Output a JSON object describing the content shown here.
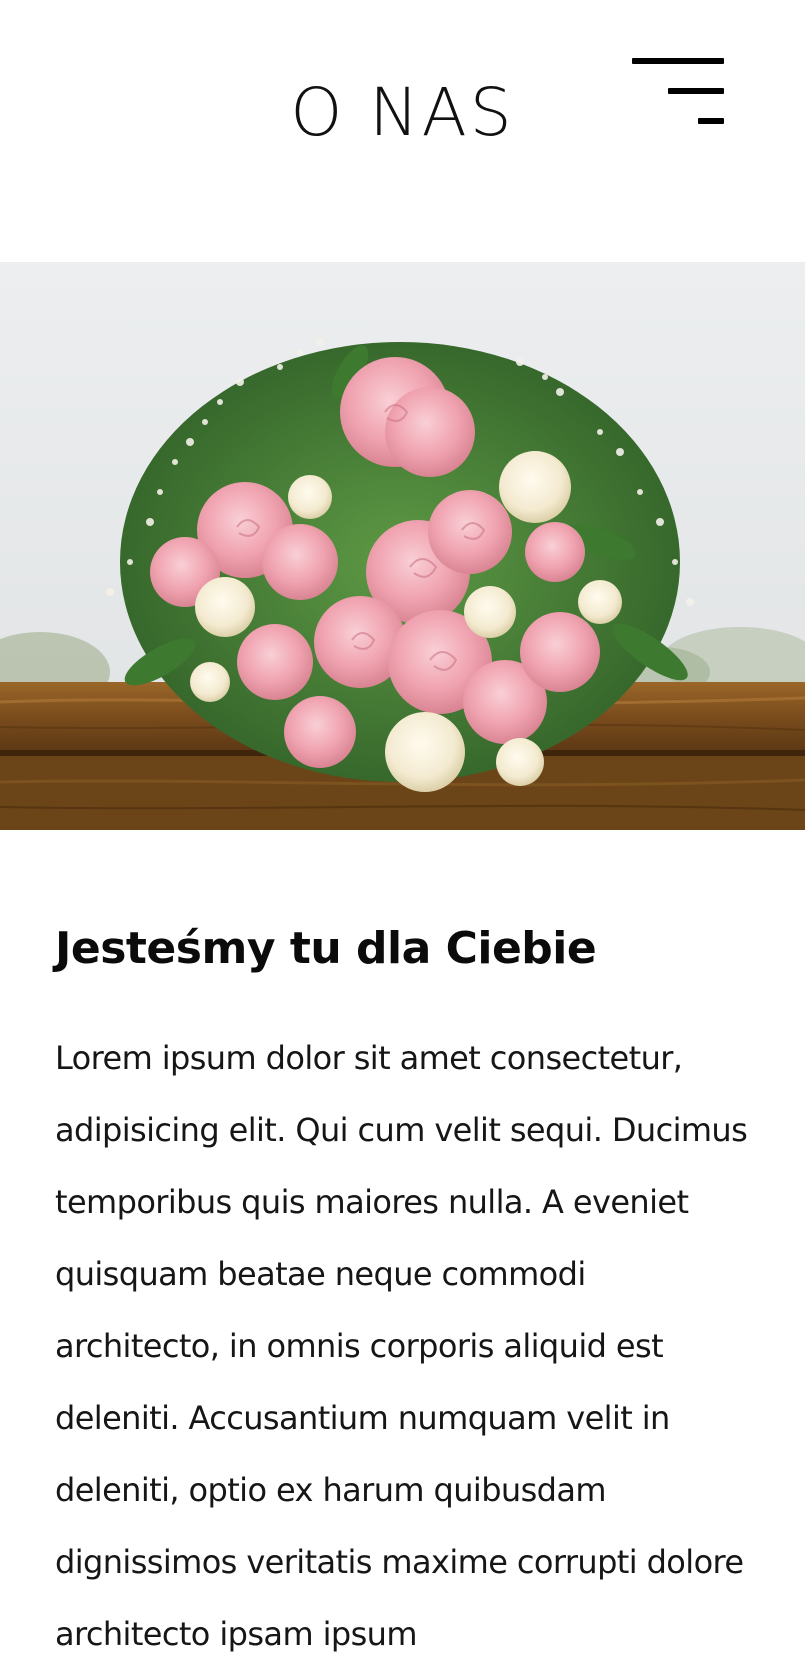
{
  "header": {
    "title": "O NAS",
    "menu_icon": "hamburger-menu-icon"
  },
  "hero": {
    "image_subject": "bouquet of pink and cream roses on a wooden fence",
    "colors": {
      "sky": "#e9eaec",
      "rose_pink": "#f0a8b4",
      "rose_cream": "#f6efd8",
      "leaf": "#3f7a34",
      "wood": "#8a5a24"
    }
  },
  "content": {
    "heading": "Jesteśmy tu dla Ciebie",
    "paragraph": "Lorem ipsum dolor sit amet consectetur, adipisicing elit. Qui cum velit sequi. Ducimus temporibus quis maiores nulla. A eveniet quisquam beatae neque commodi architecto, in omnis corporis aliquid est deleniti. Accusantium numquam velit in deleniti, optio ex harum quibusdam dignissimos veritatis maxime corrupti dolore architecto ipsam ipsum"
  }
}
